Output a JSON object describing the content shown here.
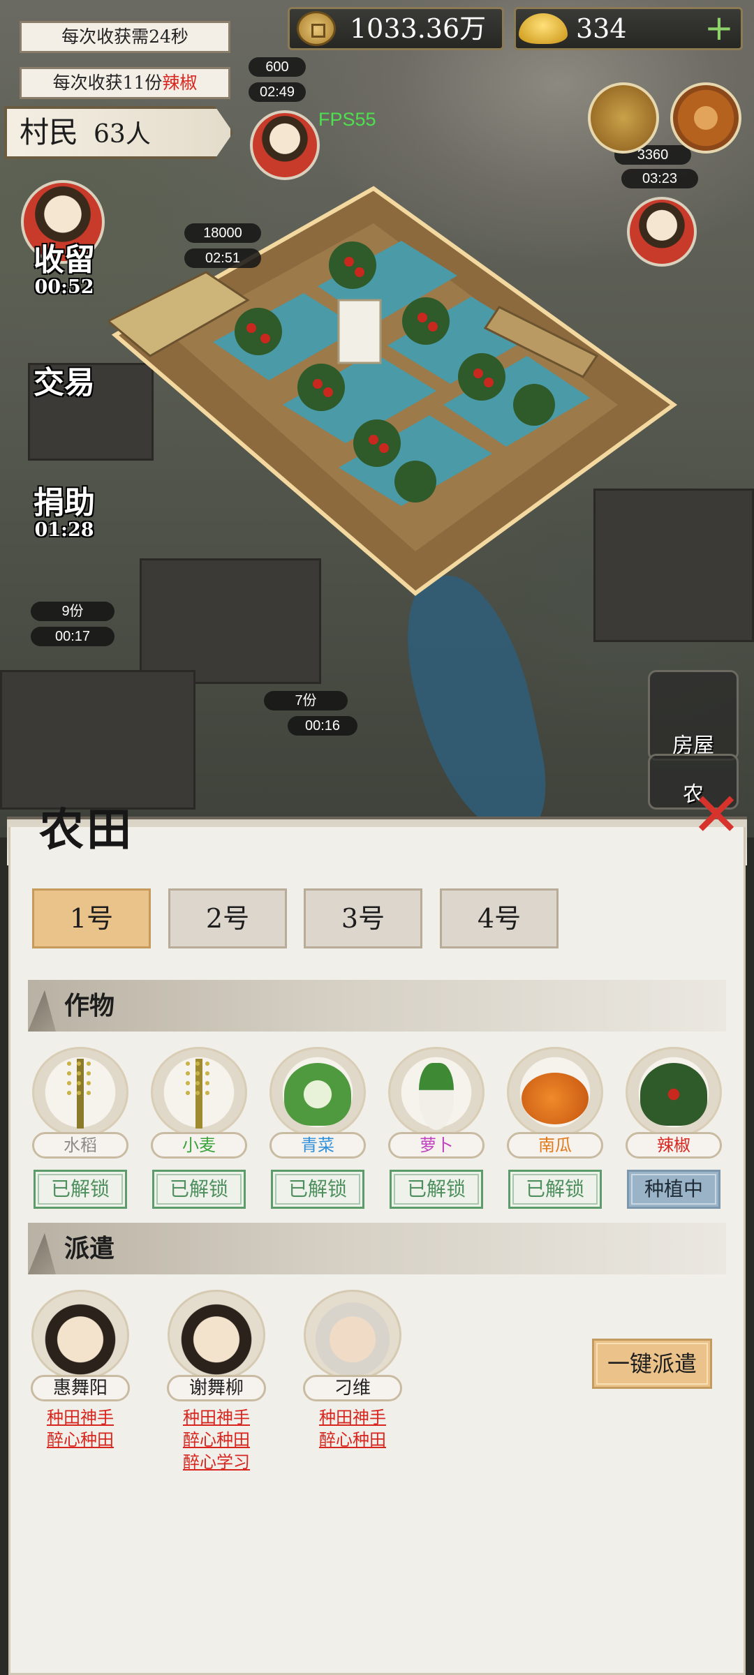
{
  "hud": {
    "harvest_time_note": "每次收获需24秒",
    "harvest_yield_prefix": "每次收获11份",
    "harvest_yield_crop": "辣椒",
    "copper_amount": "1033.36万",
    "ingot_amount": "334",
    "plus_label": "+",
    "villager_label": "村民",
    "villager_count": "63人",
    "fps": "FPS55"
  },
  "map": {
    "pills": {
      "p600": "600",
      "p0249": "02:49",
      "p18000": "18000",
      "p0251": "02:51",
      "p3360": "3360",
      "p0323": "03:23",
      "p9": "9份",
      "p0017": "00:17",
      "p7": "7份",
      "p0016": "00:16"
    },
    "side_buttons": {
      "shelter": {
        "label": "收留",
        "timer": "00:52"
      },
      "trade": {
        "label": "交易"
      },
      "donate": {
        "label": "捐助",
        "timer": "01:28"
      }
    },
    "house_label": "房屋",
    "farm_label": "农"
  },
  "panel": {
    "title": "农田",
    "close_icon": "close-icon",
    "tabs": [
      {
        "label": "1号",
        "active": true
      },
      {
        "label": "2号",
        "active": false
      },
      {
        "label": "3号",
        "active": false
      },
      {
        "label": "4号",
        "active": false
      }
    ],
    "crops_section": "作物",
    "crops": [
      {
        "name": "水稻",
        "status": "已解锁",
        "color": "#8b8b8b"
      },
      {
        "name": "小麦",
        "status": "已解锁",
        "color": "#3aa33a"
      },
      {
        "name": "青菜",
        "status": "已解锁",
        "color": "#2f8fd8"
      },
      {
        "name": "萝卜",
        "status": "已解锁",
        "color": "#c040c0"
      },
      {
        "name": "南瓜",
        "status": "已解锁",
        "color": "#e07a1a"
      },
      {
        "name": "辣椒",
        "status": "种植中",
        "color": "#d8261f"
      }
    ],
    "dispatch_section": "派遣",
    "heroes": [
      {
        "name": "惠舞阳",
        "traits": [
          "种田神手",
          "醉心种田"
        ]
      },
      {
        "name": "谢舞柳",
        "traits": [
          "种田神手",
          "醉心种田",
          "醉心学习"
        ]
      },
      {
        "name": "刁维",
        "traits": [
          "种田神手",
          "醉心种田"
        ]
      }
    ],
    "dispatch_all_label": "一键派遣"
  },
  "colors": {
    "highlight_red": "#d8261f",
    "tab_active": "#e9c38a",
    "status_green": "#4e8f5e",
    "status_growing": "#9ab3c6",
    "fps_green": "#4ee04e"
  }
}
